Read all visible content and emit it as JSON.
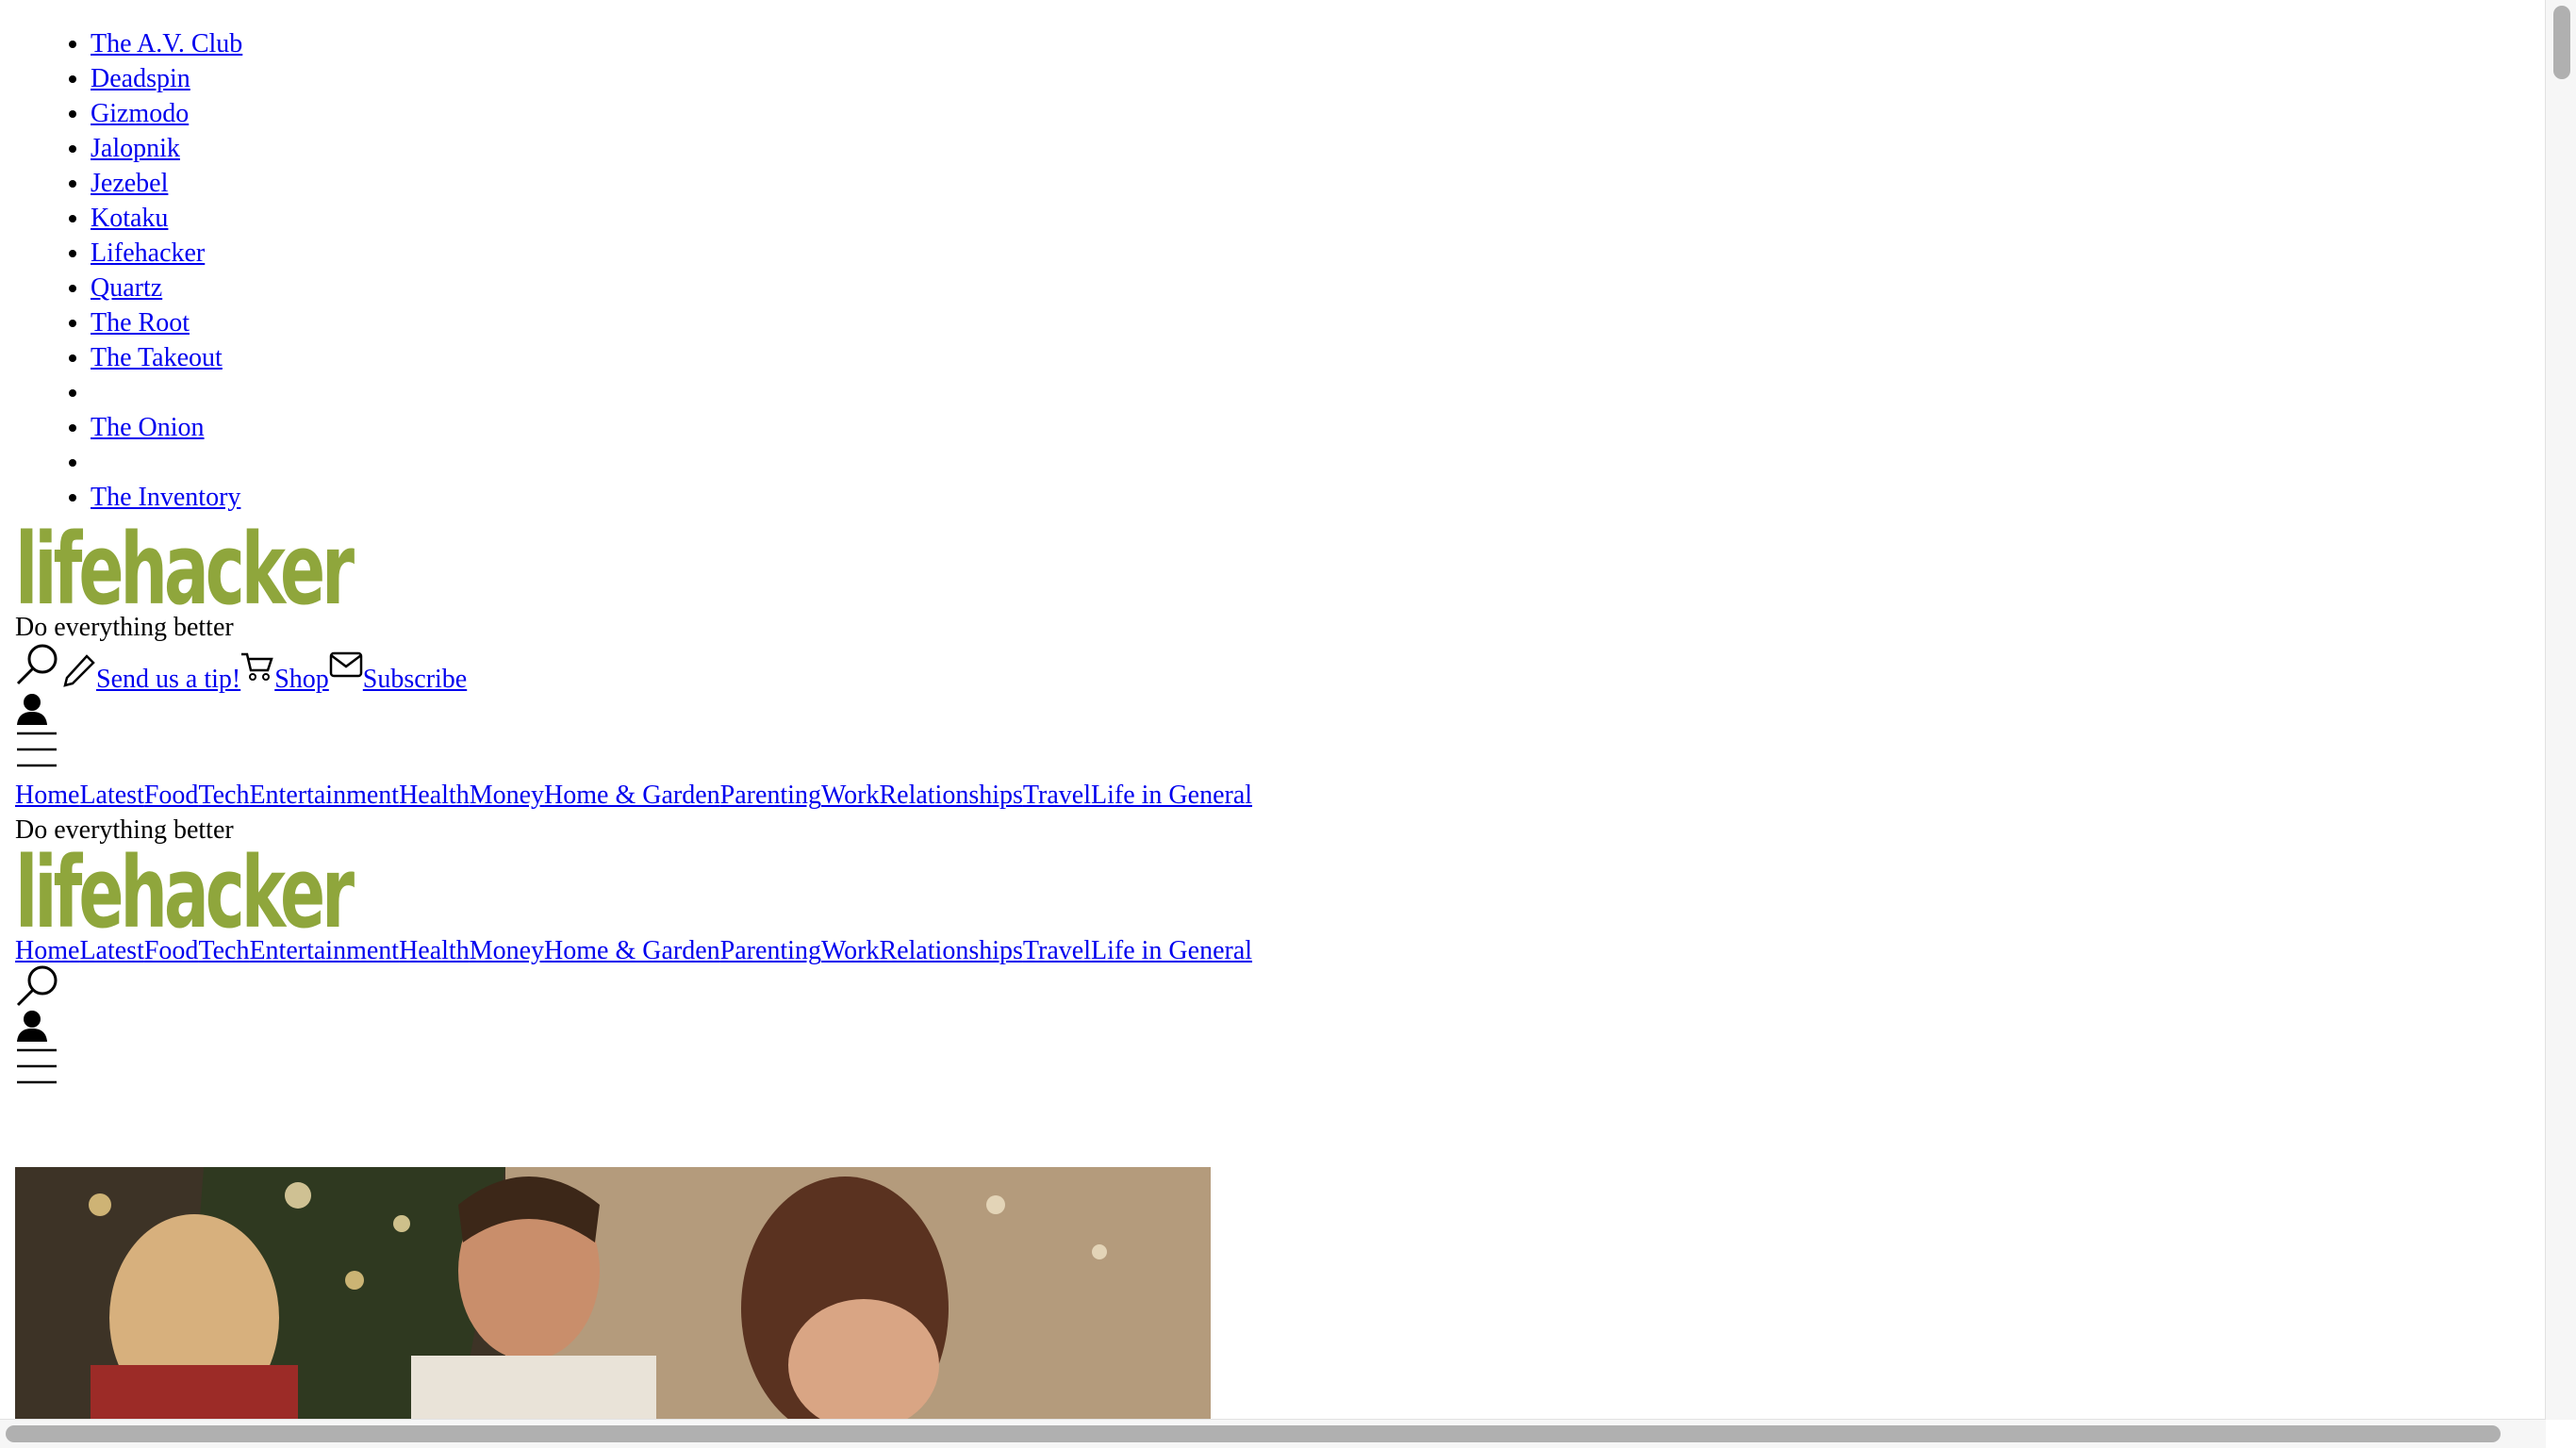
{
  "network_links": [
    "The A.V. Club",
    "Deadspin",
    "Gizmodo",
    "Jalopnik",
    "Jezebel",
    "Kotaku",
    "Lifehacker",
    "Quartz",
    "The Root",
    "The Takeout",
    "",
    "The Onion",
    "",
    "The Inventory"
  ],
  "brand": {
    "logo_text": "lifehacker",
    "logo_color": "#8fa63c",
    "tagline": "Do everything better"
  },
  "utility": {
    "tip_label": "Send us a tip!",
    "shop_label": "Shop",
    "subscribe_label": "Subscribe"
  },
  "nav": [
    "Home",
    "Latest",
    "Food",
    "Tech",
    "Entertainment",
    "Health",
    "Money",
    "Home & Garden",
    "Parenting",
    "Work",
    "Relationships",
    "Travel",
    "Life in General"
  ],
  "icons": {
    "search": "search-icon",
    "pencil": "pencil-icon",
    "cart": "cart-icon",
    "mail": "mail-icon",
    "user": "user-icon",
    "menu": "hamburger-menu-icon"
  }
}
